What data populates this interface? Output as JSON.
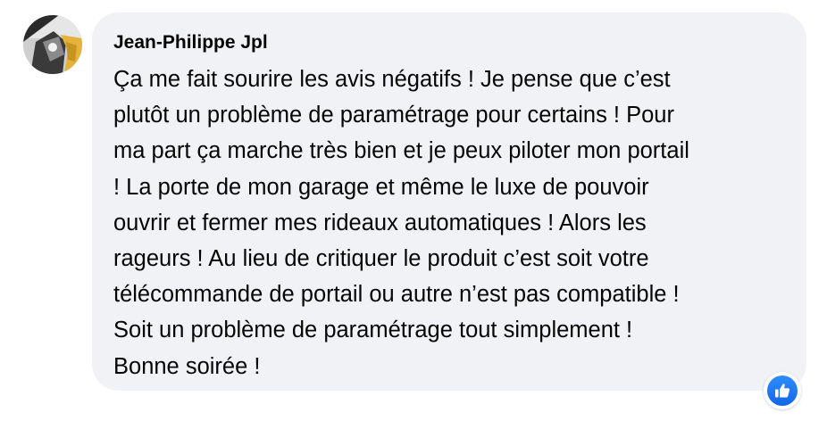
{
  "comment": {
    "author": "Jean-Philippe Jpl",
    "lines": [
      "Ça me fait sourire les avis négatifs ! Je pense que c’est",
      "plutôt un problème de paramétrage pour certains ! Pour",
      "ma part ça marche très bien et je peux piloter mon portail",
      "! La porte de mon garage et même le luxe de pouvoir",
      "ouvrir et fermer mes rideaux automatiques ! Alors les",
      "rageurs ! Au lieu de critiquer le produit c’est soit votre",
      "télécommande de portail ou autre n’est pas compatible !",
      "Soit un problème de paramétrage tout simplement !",
      "Bonne soirée !"
    ],
    "reactions": [
      {
        "type": "like",
        "icon": "thumbs-up-icon",
        "color": "#1877f2"
      }
    ]
  },
  "colors": {
    "bubble_background": "#f0f2f5",
    "text": "#050505",
    "like_blue": "#1877f2"
  }
}
